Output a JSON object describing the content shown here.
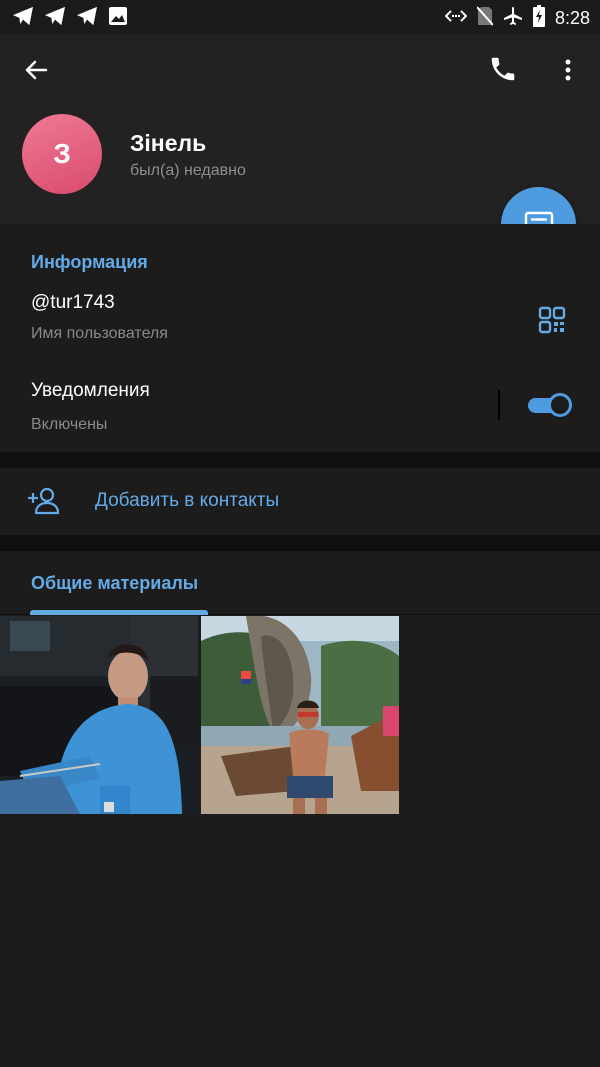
{
  "statusbar": {
    "time": "8:28",
    "left_icons": [
      "telegram-icon",
      "telegram-icon",
      "telegram-icon",
      "image-icon"
    ],
    "right_icons": [
      "data-transfer-icon",
      "no-sim-icon",
      "airplane-mode-icon",
      "battery-charging-icon"
    ]
  },
  "header": {
    "avatar_letter": "З",
    "name": "Зінель",
    "status": "был(а) недавно"
  },
  "info": {
    "section_title": "Информация",
    "username": "@tur1743",
    "username_label": "Имя пользователя",
    "notifications_title": "Уведомления",
    "notifications_label": "Включены",
    "notifications_on": true
  },
  "actions": {
    "add_contact_label": "Добавить в контакты"
  },
  "shared": {
    "tab_label": "Общие материалы",
    "photos": [
      {
        "subject": "man in blue shirt sitting indoors"
      },
      {
        "subject": "man on beach with longtail boats and limestone rock"
      }
    ]
  },
  "colors": {
    "accent": "#64aae6",
    "fab": "#4f9be0",
    "avatar": "#e5617f"
  }
}
